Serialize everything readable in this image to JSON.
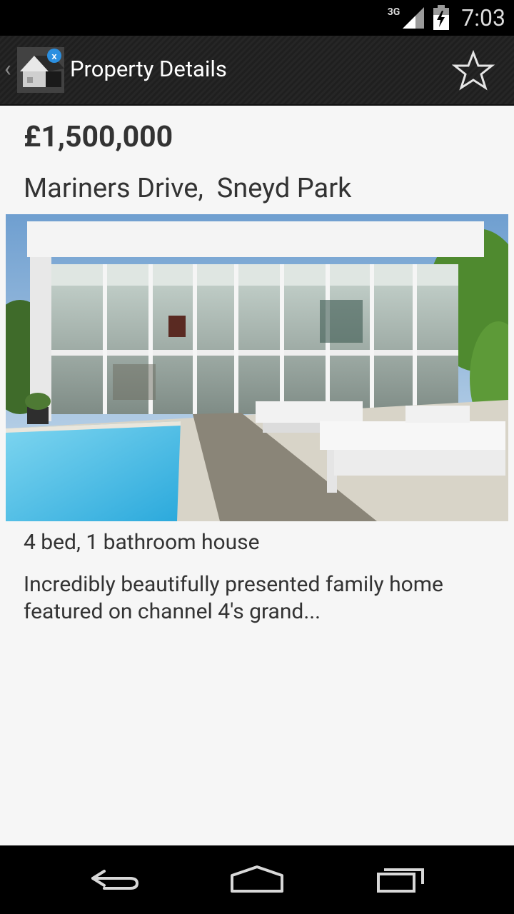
{
  "status_bar": {
    "network_type": "3G",
    "time": "7:03"
  },
  "action_bar": {
    "title": "Property Details",
    "app_icon": "house-app-icon",
    "favorite_icon": "star-outline-icon"
  },
  "listing": {
    "price": "£1,500,000",
    "address": "Mariners Drive,  Sneyd Park",
    "summary": "4 bed, 1 bathroom house",
    "description": "Incredibly beautifully presented family home featured on channel 4's grand..."
  },
  "nav_bar": {
    "back_icon": "back-arrow-icon",
    "home_icon": "home-icon",
    "recents_icon": "recents-icon"
  },
  "colors": {
    "background": "#f6f6f6",
    "text": "#333333",
    "action_bar": "#222222",
    "badge": "#2b8fe0"
  }
}
